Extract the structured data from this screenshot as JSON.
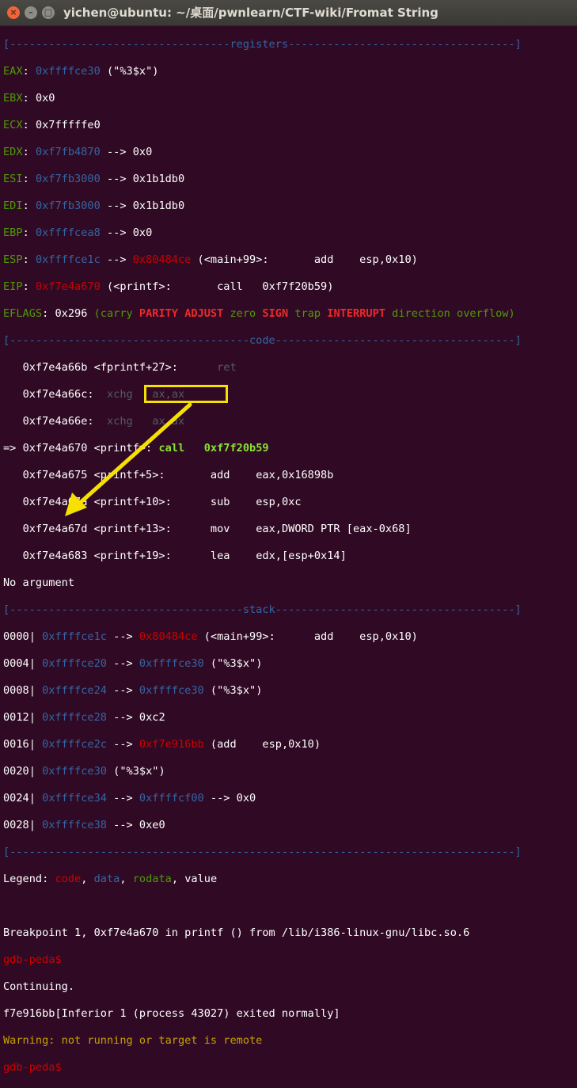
{
  "window": {
    "title": "yichen@ubuntu: ~/桌面/pwnlearn/CTF-wiki/Fromat String",
    "close_glyph": "×",
    "min_glyph": "–",
    "max_glyph": "□"
  },
  "registers": {
    "header": "[----------------------------------registers-----------------------------------]",
    "eax": {
      "name": "EAX",
      "addr": "0xffffce30",
      "rest": " (\"%3$x\")"
    },
    "ebx": {
      "name": "EBX",
      "value": "0x0"
    },
    "ecx": {
      "name": "ECX",
      "value": "0x7fffffe0"
    },
    "edx": {
      "name": "EDX",
      "addr": "0xf7fb4870",
      "rest": " --> 0x0"
    },
    "esi": {
      "name": "ESI",
      "addr": "0xf7fb3000",
      "rest": " --> 0x1b1db0"
    },
    "edi": {
      "name": "EDI",
      "addr": "0xf7fb3000",
      "rest": " --> 0x1b1db0"
    },
    "ebp": {
      "name": "EBP",
      "addr": "0xffffcea8",
      "rest": " --> 0x0"
    },
    "esp": {
      "name": "ESP",
      "addr": "0xffffce1c",
      "arrow": " --> ",
      "ptr": "0x80484ce",
      "rest": " (<main+99>:       add    esp,0x10)"
    },
    "eip": {
      "name": "EIP",
      "addr": "0xf7e4a670",
      "rest": " (<printf>:       call   0xf7f20b59)"
    },
    "eflags": {
      "name": "EFLAGS",
      "value": "0x296",
      "open": " (",
      "flags": [
        "carry",
        "PARITY",
        "ADJUST",
        "zero",
        "SIGN",
        "trap",
        "INTERRUPT",
        "direction",
        "overflow"
      ],
      "close": ")"
    }
  },
  "code": {
    "header": "[-------------------------------------code-------------------------------------]",
    "lines": [
      {
        "prefix": "   ",
        "text": "0xf7e4a66b <fprintf+27>:",
        "gap": "      ",
        "instr": "ret",
        "style": "gray"
      },
      {
        "prefix": "   ",
        "text": "0xf7e4a66c:",
        "gap": "  ",
        "instr": "xchg   ax,ax",
        "style": "gray"
      },
      {
        "prefix": "   ",
        "text": "0xf7e4a66e:",
        "gap": "  ",
        "instr": "xchg   ax,ax",
        "style": "gray"
      },
      {
        "prefix": "=> ",
        "text": "0xf7e4a670 <printf>:",
        "gap": " ",
        "instr": "call   0xf7f20b59",
        "style": "current"
      },
      {
        "prefix": "   ",
        "text": "0xf7e4a675 <printf+5>:",
        "gap": "       ",
        "instr": "add    eax,0x16898b",
        "style": "normal"
      },
      {
        "prefix": "   ",
        "text": "0xf7e4a67a <printf+10>:",
        "gap": "      ",
        "instr": "sub    esp,0xc",
        "style": "normal"
      },
      {
        "prefix": "   ",
        "text": "0xf7e4a67d <printf+13>:",
        "gap": "      ",
        "instr": "mov    eax,DWORD PTR [eax-0x68]",
        "style": "normal"
      },
      {
        "prefix": "   ",
        "text": "0xf7e4a683 <printf+19>:",
        "gap": "      ",
        "instr": "lea    edx,[esp+0x14]",
        "style": "normal"
      }
    ],
    "no_argument": "No argument"
  },
  "stack": {
    "header": "[------------------------------------stack-------------------------------------]",
    "rows": [
      {
        "off": "0000",
        "addr": "0xffffce1c",
        "arrow": " --> ",
        "ptr": "0x80484ce",
        "ptr_style": "red",
        "rest": " (<main+99>:      add    esp,0x10)"
      },
      {
        "off": "0004",
        "addr": "0xffffce20",
        "arrow": " --> ",
        "ptr": "0xffffce30",
        "ptr_style": "blue",
        "rest": " (\"%3$x\")"
      },
      {
        "off": "0008",
        "addr": "0xffffce24",
        "arrow": " --> ",
        "ptr": "0xffffce30",
        "ptr_style": "blue",
        "rest": " (\"%3$x\")"
      },
      {
        "off": "0012",
        "addr": "0xffffce28",
        "arrow": " --> ",
        "ptr": "0xc2",
        "ptr_style": "white",
        "rest": ""
      },
      {
        "off": "0016",
        "addr": "0xffffce2c",
        "arrow": " --> ",
        "ptr": "0xf7e916bb",
        "ptr_style": "red",
        "rest": " (add    esp,0x10)"
      },
      {
        "off": "0020",
        "addr": "0xffffce30",
        "arrow": "",
        "ptr": "",
        "ptr_style": "white",
        "rest": " (\"%3$x\")"
      },
      {
        "off": "0024",
        "addr": "0xffffce34",
        "arrow": " --> ",
        "ptr": "0xffffcf00",
        "ptr_style": "blue",
        "rest": " --> 0x0"
      },
      {
        "off": "0028",
        "addr": "0xffffce38",
        "arrow": " --> ",
        "ptr": "0xe0",
        "ptr_style": "white",
        "rest": ""
      }
    ],
    "footer": "[------------------------------------------------------------------------------]"
  },
  "legend": {
    "label": "Legend: ",
    "code": "code",
    "sep1": ", ",
    "data": "data",
    "sep2": ", ",
    "rodata": "rodata",
    "sep3": ", ",
    "value": "value"
  },
  "output": {
    "breakpoint": "Breakpoint 1, 0xf7e4a670 in printf () from /lib/i386-linux-gnu/libc.so.6",
    "prompt": "gdb-peda$",
    "continuing": "Continuing.",
    "result": "f7e916bb[Inferior 1 (process 43027) exited normally]",
    "warning": "Warning: not running or target is remote"
  },
  "colors": {
    "background": "#300a24",
    "address_blue": "#3465a4",
    "register_green": "#4e9a06",
    "code_red": "#cc0000",
    "highlight_yellow": "#f5e000",
    "warning_yellow": "#c4a000"
  }
}
